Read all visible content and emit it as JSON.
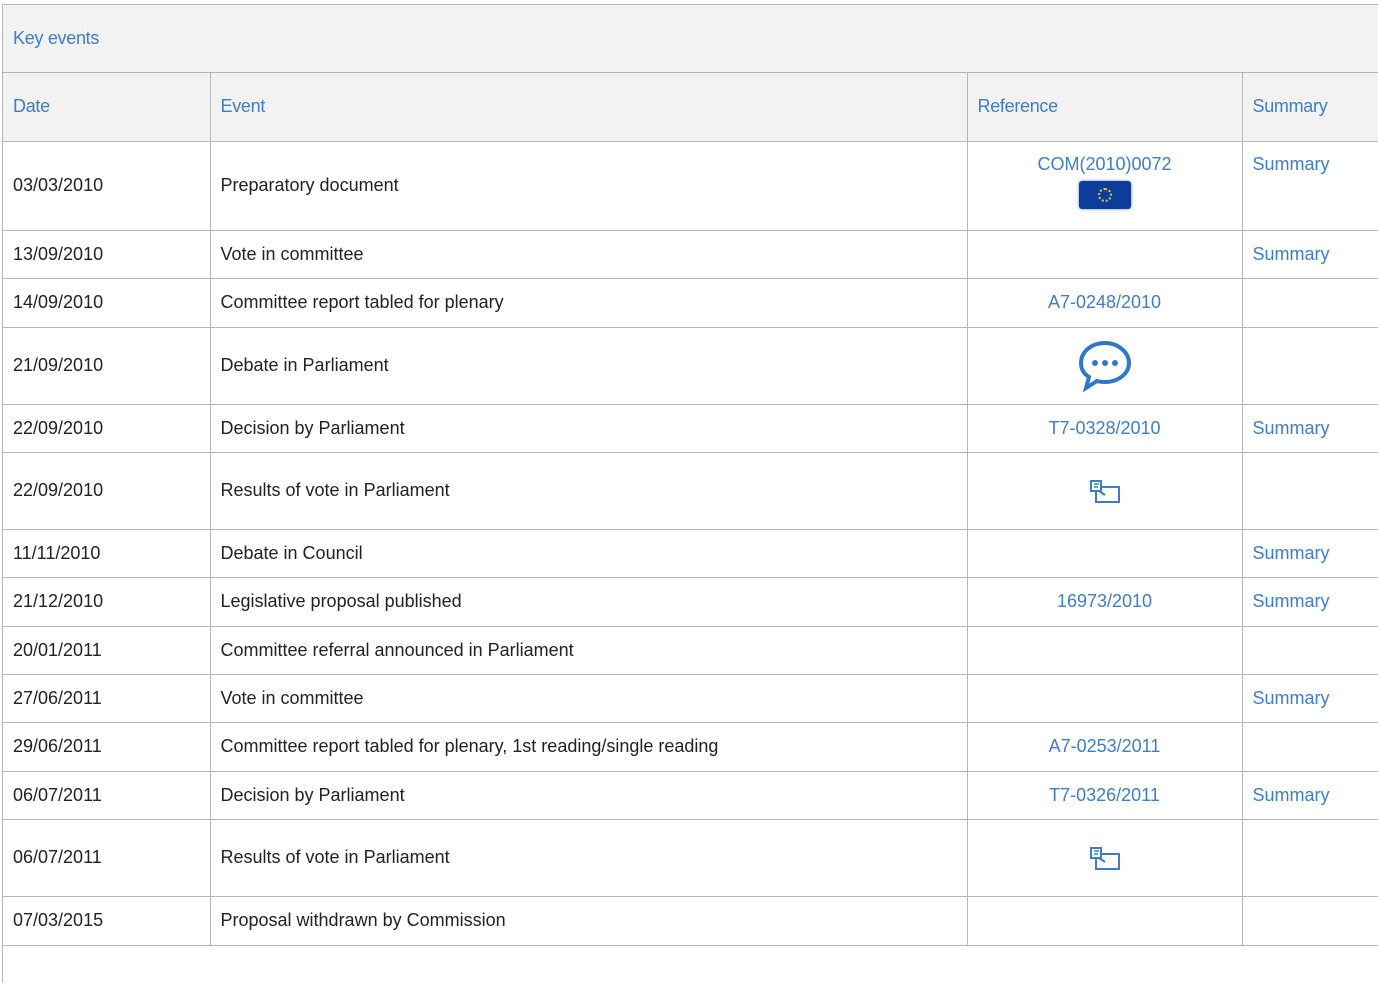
{
  "panel": {
    "title": "Key events"
  },
  "table": {
    "headers": {
      "date": "Date",
      "event": "Event",
      "reference": "Reference",
      "summary": "Summary"
    },
    "rows": [
      {
        "date": "03/03/2010",
        "event": "Preparatory document",
        "reference": "COM(2010)0072",
        "reference_icon": "eu-flag-icon",
        "summary": "Summary"
      },
      {
        "date": "13/09/2010",
        "event": "Vote in committee",
        "reference": "",
        "reference_icon": "",
        "summary": "Summary"
      },
      {
        "date": "14/09/2010",
        "event": "Committee report tabled for plenary",
        "reference": "A7-0248/2010",
        "reference_icon": "",
        "summary": ""
      },
      {
        "date": "21/09/2010",
        "event": "Debate in Parliament",
        "reference": "",
        "reference_icon": "speech-bubble-icon",
        "summary": ""
      },
      {
        "date": "22/09/2010",
        "event": "Decision by Parliament",
        "reference": "T7-0328/2010",
        "reference_icon": "",
        "summary": "Summary"
      },
      {
        "date": "22/09/2010",
        "event": "Results of vote in Parliament",
        "reference": "",
        "reference_icon": "ballot-vote-icon",
        "summary": ""
      },
      {
        "date": "11/11/2010",
        "event": "Debate in Council",
        "reference": "",
        "reference_icon": "",
        "summary": "Summary"
      },
      {
        "date": "21/12/2010",
        "event": "Legislative proposal published",
        "reference": "16973/2010",
        "reference_icon": "",
        "summary": "Summary"
      },
      {
        "date": "20/01/2011",
        "event": "Committee referral announced in Parliament",
        "reference": "",
        "reference_icon": "",
        "summary": ""
      },
      {
        "date": "27/06/2011",
        "event": "Vote in committee",
        "reference": "",
        "reference_icon": "",
        "summary": "Summary"
      },
      {
        "date": "29/06/2011",
        "event": "Committee report tabled for plenary, 1st reading/single reading",
        "reference": "A7-0253/2011",
        "reference_icon": "",
        "summary": ""
      },
      {
        "date": "06/07/2011",
        "event": "Decision by Parliament",
        "reference": "T7-0326/2011",
        "reference_icon": "",
        "summary": "Summary"
      },
      {
        "date": "06/07/2011",
        "event": "Results of vote in Parliament",
        "reference": "",
        "reference_icon": "ballot-vote-icon",
        "summary": ""
      },
      {
        "date": "07/03/2015",
        "event": "Proposal withdrawn by Commission",
        "reference": "",
        "reference_icon": "",
        "summary": ""
      }
    ]
  },
  "colors": {
    "link": "#3f7dc4",
    "header_bg": "#f2f2f2",
    "border": "#b5b5b5",
    "text": "#222222",
    "eu_blue": "#0d3c9b"
  }
}
